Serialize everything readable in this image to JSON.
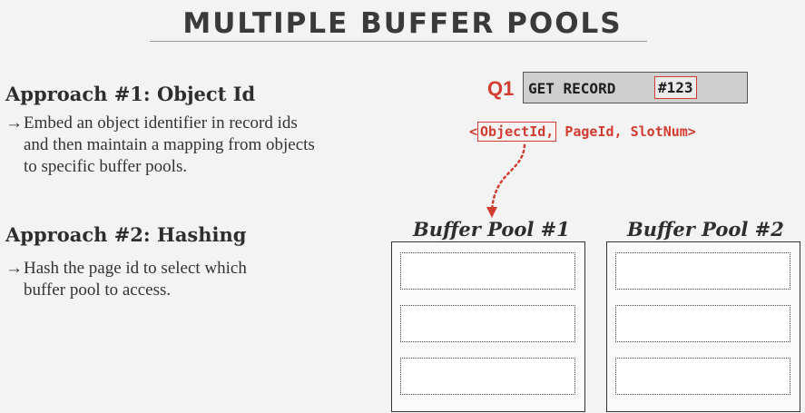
{
  "slide": {
    "title": "MULTIPLE BUFFER POOLS"
  },
  "approach1": {
    "heading": "Approach #1: Object Id",
    "arrow": "→",
    "lines": [
      "Embed an object identifier in record ids",
      "and then maintain a mapping from objects",
      "to specific buffer pools."
    ]
  },
  "approach2": {
    "heading": "Approach #2: Hashing",
    "arrow": "→",
    "lines": [
      "Hash the page id to select which",
      "buffer pool to access."
    ]
  },
  "query": {
    "label": "Q1",
    "command": "GET RECORD",
    "record_id": "#123"
  },
  "record_tuple": {
    "open": "<",
    "object_id": "ObjectId,",
    "rest": " PageId, SlotNum>"
  },
  "pools": [
    {
      "title": "Buffer Pool #1"
    },
    {
      "title": "Buffer Pool #2"
    }
  ],
  "colors": {
    "accent": "#d23b2f",
    "background": "#f3f3f3",
    "query_box": "#cfcfcf"
  }
}
